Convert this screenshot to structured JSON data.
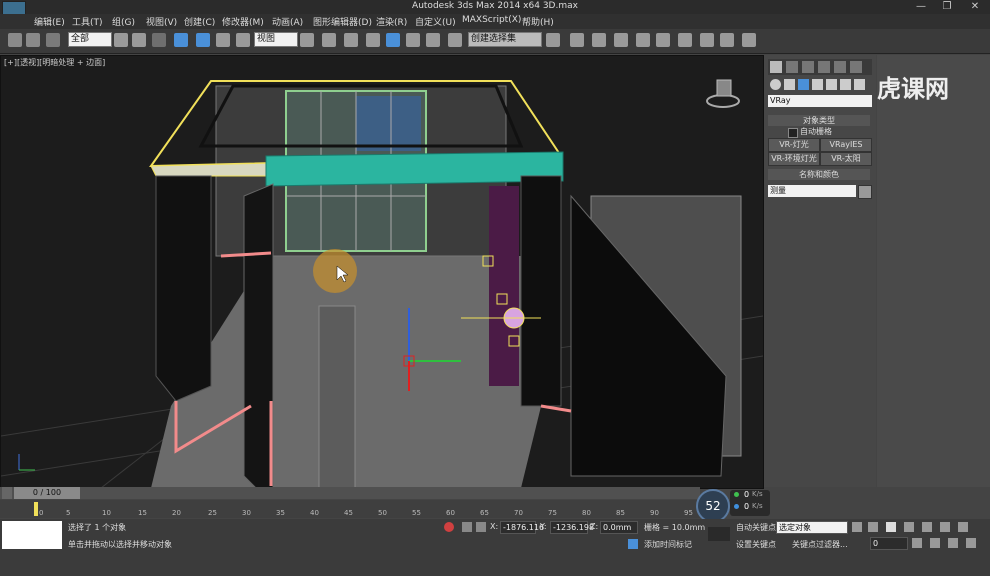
{
  "window": {
    "title": "Autodesk 3ds Max  2014 x64      3D.max"
  },
  "menu": {
    "items": [
      "编辑(E)",
      "工具(T)",
      "组(G)",
      "视图(V)",
      "创建(C)",
      "修改器(M)",
      "动画(A)",
      "图形编辑器(D)",
      "渲染(R)",
      "自定义(U)",
      "MAXScript(X)",
      "帮助(H)"
    ]
  },
  "toolbar": {
    "selection_filter": "全部",
    "reference_coord": "视图",
    "named_selection": "创建选择集"
  },
  "viewport": {
    "label": "[+][透视][明暗处理 + 边面]"
  },
  "command_panel": {
    "renderer_dropdown": "VRay",
    "object_type_header": "对象类型",
    "auto_grid_label": "自动栅格",
    "buttons": [
      "VR-灯光",
      "VRayIES",
      "VR-环境灯光",
      "VR-太阳"
    ],
    "name_color_header": "名称和颜色",
    "name_field": "测量"
  },
  "timeline": {
    "frame_counter": "0 / 100",
    "ticks": [
      "0",
      "5",
      "10",
      "15",
      "20",
      "25",
      "30",
      "35",
      "40",
      "45",
      "50",
      "55",
      "60",
      "65",
      "70",
      "75",
      "80",
      "85",
      "90",
      "95"
    ]
  },
  "status": {
    "selection_msg": "选择了 1 个对象",
    "prompt_msg": "单击并拖动以选择并移动对象",
    "x_label": "X:",
    "x_value": "-1876.116",
    "y_label": "Y:",
    "y_value": "-1236.198",
    "z_label": "Z:",
    "z_value": "0.0mm",
    "grid_label": "栅格 = 10.0mm",
    "add_time_tag": "添加时间标记",
    "auto_key": "自动关键点",
    "selected_dropdown": "选定对象",
    "set_key": "设置关键点",
    "key_filters": "关键点过滤器...",
    "frame_field": "0",
    "fps": "52",
    "net_up": "0",
    "net_down": "0",
    "net_unit": "K/s"
  },
  "watermark": {
    "text": "虎课网"
  },
  "colors": {
    "accent": "#2bb5a0",
    "selection_yellow": "#f1e05a",
    "wall_pink": "#f28b8b"
  }
}
